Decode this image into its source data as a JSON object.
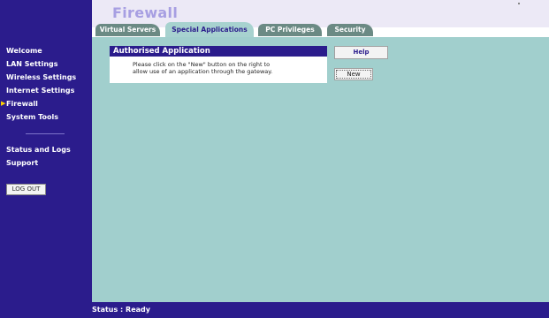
{
  "header": {
    "title": "Firewall"
  },
  "tabs": [
    {
      "label": "Virtual Servers",
      "active": false
    },
    {
      "label": "Special Applications",
      "active": true
    },
    {
      "label": "PC Privileges",
      "active": false
    },
    {
      "label": "Security",
      "active": false
    }
  ],
  "sidebar": {
    "items": [
      {
        "label": "Welcome"
      },
      {
        "label": "LAN Settings"
      },
      {
        "label": "Wireless Settings"
      },
      {
        "label": "Internet Settings"
      },
      {
        "label": "Firewall",
        "arrow": "▶"
      },
      {
        "label": "System Tools"
      },
      {
        "label": "Status and Logs"
      },
      {
        "label": "Support"
      }
    ],
    "logout_label": "LOG OUT"
  },
  "panel": {
    "title": "Authorised Application",
    "line1": "Please click on the \"New\" button on the right to",
    "line2": "allow use of an application through the gateway."
  },
  "buttons": {
    "help": "Help",
    "new": "New"
  },
  "status": {
    "text": "Status : Ready"
  },
  "colors": {
    "sidebar": "#2b1c8c",
    "content": "#a1cfcd",
    "active_tab": "#a7d2cf",
    "inactive_tab": "#6b8a84",
    "title": "#a79fe2"
  }
}
